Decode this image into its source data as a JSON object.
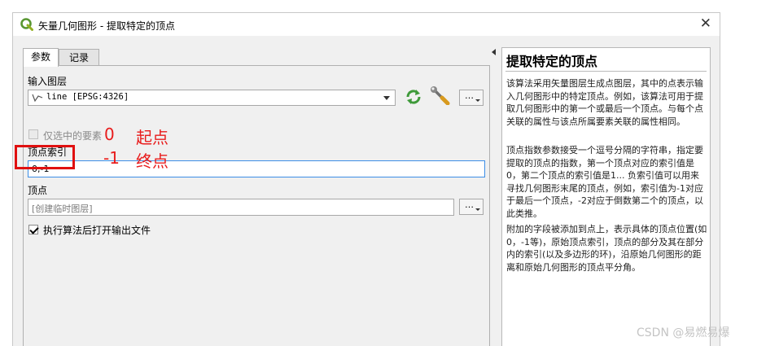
{
  "window": {
    "title": "矢量几何图形 - 提取特定的顶点",
    "app_icon": "qgis-icon",
    "close_symbol": "✕"
  },
  "tabs": [
    {
      "label": "参数",
      "active": true
    },
    {
      "label": "记录",
      "active": false
    }
  ],
  "params": {
    "input_layer_label": "输入图层",
    "input_layer_value": "line [EPSG:4326]",
    "input_layer_icon": "line-layer-icon",
    "iterate_icon": "iterate-features-icon",
    "advanced_icon": "wrench-icon",
    "more_button": "…",
    "selected_only_label": "仅选中的要素",
    "selected_only_checked": false,
    "vertex_indices_label": "顶点索引",
    "vertex_indices_value": "0,-1",
    "output_label": "顶点",
    "output_placeholder": "[创建临时图层]",
    "open_output_label": "执行算法后打开输出文件",
    "open_output_checked": true
  },
  "annotations": {
    "first_index": "0",
    "first_label": "起点",
    "last_index": "-1",
    "last_label": "终点",
    "highlight_color": "#e01010"
  },
  "help": {
    "title": "提取特定的顶点",
    "paragraphs": [
      "该算法采用矢量图层生成点图层，其中的点表示输入几何图形中的特定顶点。例如，该算法可用于提取几何图形中的第一个或最后一个顶点。与每个点关联的属性与该点所属要素关联的属性相同。",
      "顶点指数参数接受一个逗号分隔的字符串，指定要提取的顶点的指数，第一个顶点对应的索引值是0，第二个顶点的索引值是1... 负索引值可以用来寻找几何图形末尾的顶点，例如，索引值为-1对应于最后一个顶点，-2对应于倒数第二个的顶点，以此类推。",
      "附加的字段被添加到点上，表示具体的顶点位置(如0，-1等)，原始顶点索引，顶点的部分及其在部分内的索引(以及多边形的环)，沿原始几何图形的距离和原始几何图形的顶点平分角。"
    ]
  },
  "watermark": "CSDN @易燃易爆"
}
